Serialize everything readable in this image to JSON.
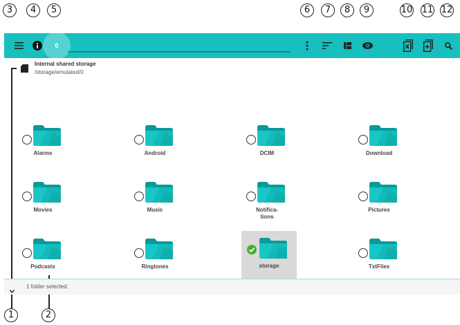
{
  "toolbar": {
    "counter": "0",
    "accent_color": "#17bfbf",
    "icons": [
      "menu-icon",
      "info-icon",
      "more-vert-icon",
      "sort-icon",
      "view-grid-icon",
      "eye-icon",
      "deselect-icon",
      "select-all-icon",
      "search-icon"
    ]
  },
  "storage": {
    "title": "Internal shared storage",
    "path": "/storage/emulated/0"
  },
  "folders": [
    {
      "name": "Alarms",
      "selected": false
    },
    {
      "name": "Android",
      "selected": false
    },
    {
      "name": "DCIM",
      "selected": false
    },
    {
      "name": "Download",
      "selected": false
    },
    {
      "name": "Movies",
      "selected": false
    },
    {
      "name": "Music",
      "selected": false
    },
    {
      "name": "Notifica-\ntions",
      "selected": false
    },
    {
      "name": "Pictures",
      "selected": false
    },
    {
      "name": "Podcasts",
      "selected": false
    },
    {
      "name": "Ringtones",
      "selected": false
    },
    {
      "name": "storage",
      "selected": true
    },
    {
      "name": "TxtFiles",
      "selected": false
    }
  ],
  "status": {
    "text": "1 folder selected."
  },
  "callouts": [
    "1",
    "2",
    "3",
    "4",
    "5",
    "6",
    "7",
    "8",
    "9",
    "10",
    "11",
    "12"
  ]
}
